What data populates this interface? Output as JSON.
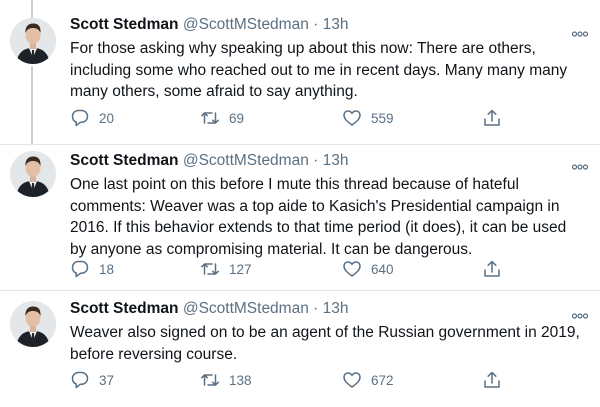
{
  "tweets": [
    {
      "name": "Scott Stedman",
      "handle": "@ScottMStedman",
      "separator": "·",
      "time": "13h",
      "text": "For those asking why speaking up about this now: There are others, including some who reached out to me in recent days. Many many many many others, some afraid to say anything.",
      "replies": "20",
      "retweets": "69",
      "likes": "559"
    },
    {
      "name": "Scott Stedman",
      "handle": "@ScottMStedman",
      "separator": "·",
      "time": "13h",
      "text": "One last point on this before I mute this thread because of hateful comments: Weaver was a top aide to Kasich's Presidential campaign in 2016. If this behavior extends to that time period (it does), it can be used by anyone as compromising material. It can be dangerous.",
      "replies": "18",
      "retweets": "127",
      "likes": "640"
    },
    {
      "name": "Scott Stedman",
      "handle": "@ScottMStedman",
      "separator": "·",
      "time": "13h",
      "text": "Weaver also signed on to be an agent of the Russian government in 2019, before reversing course.",
      "replies": "37",
      "retweets": "138",
      "likes": "672"
    }
  ],
  "icons": {
    "more": "more-icon",
    "reply": "reply-icon",
    "retweet": "retweet-icon",
    "like": "heart-icon",
    "share": "share-icon"
  },
  "colors": {
    "text": "#0f1419",
    "secondary": "#5b7083",
    "divider": "#e1e6ea"
  }
}
